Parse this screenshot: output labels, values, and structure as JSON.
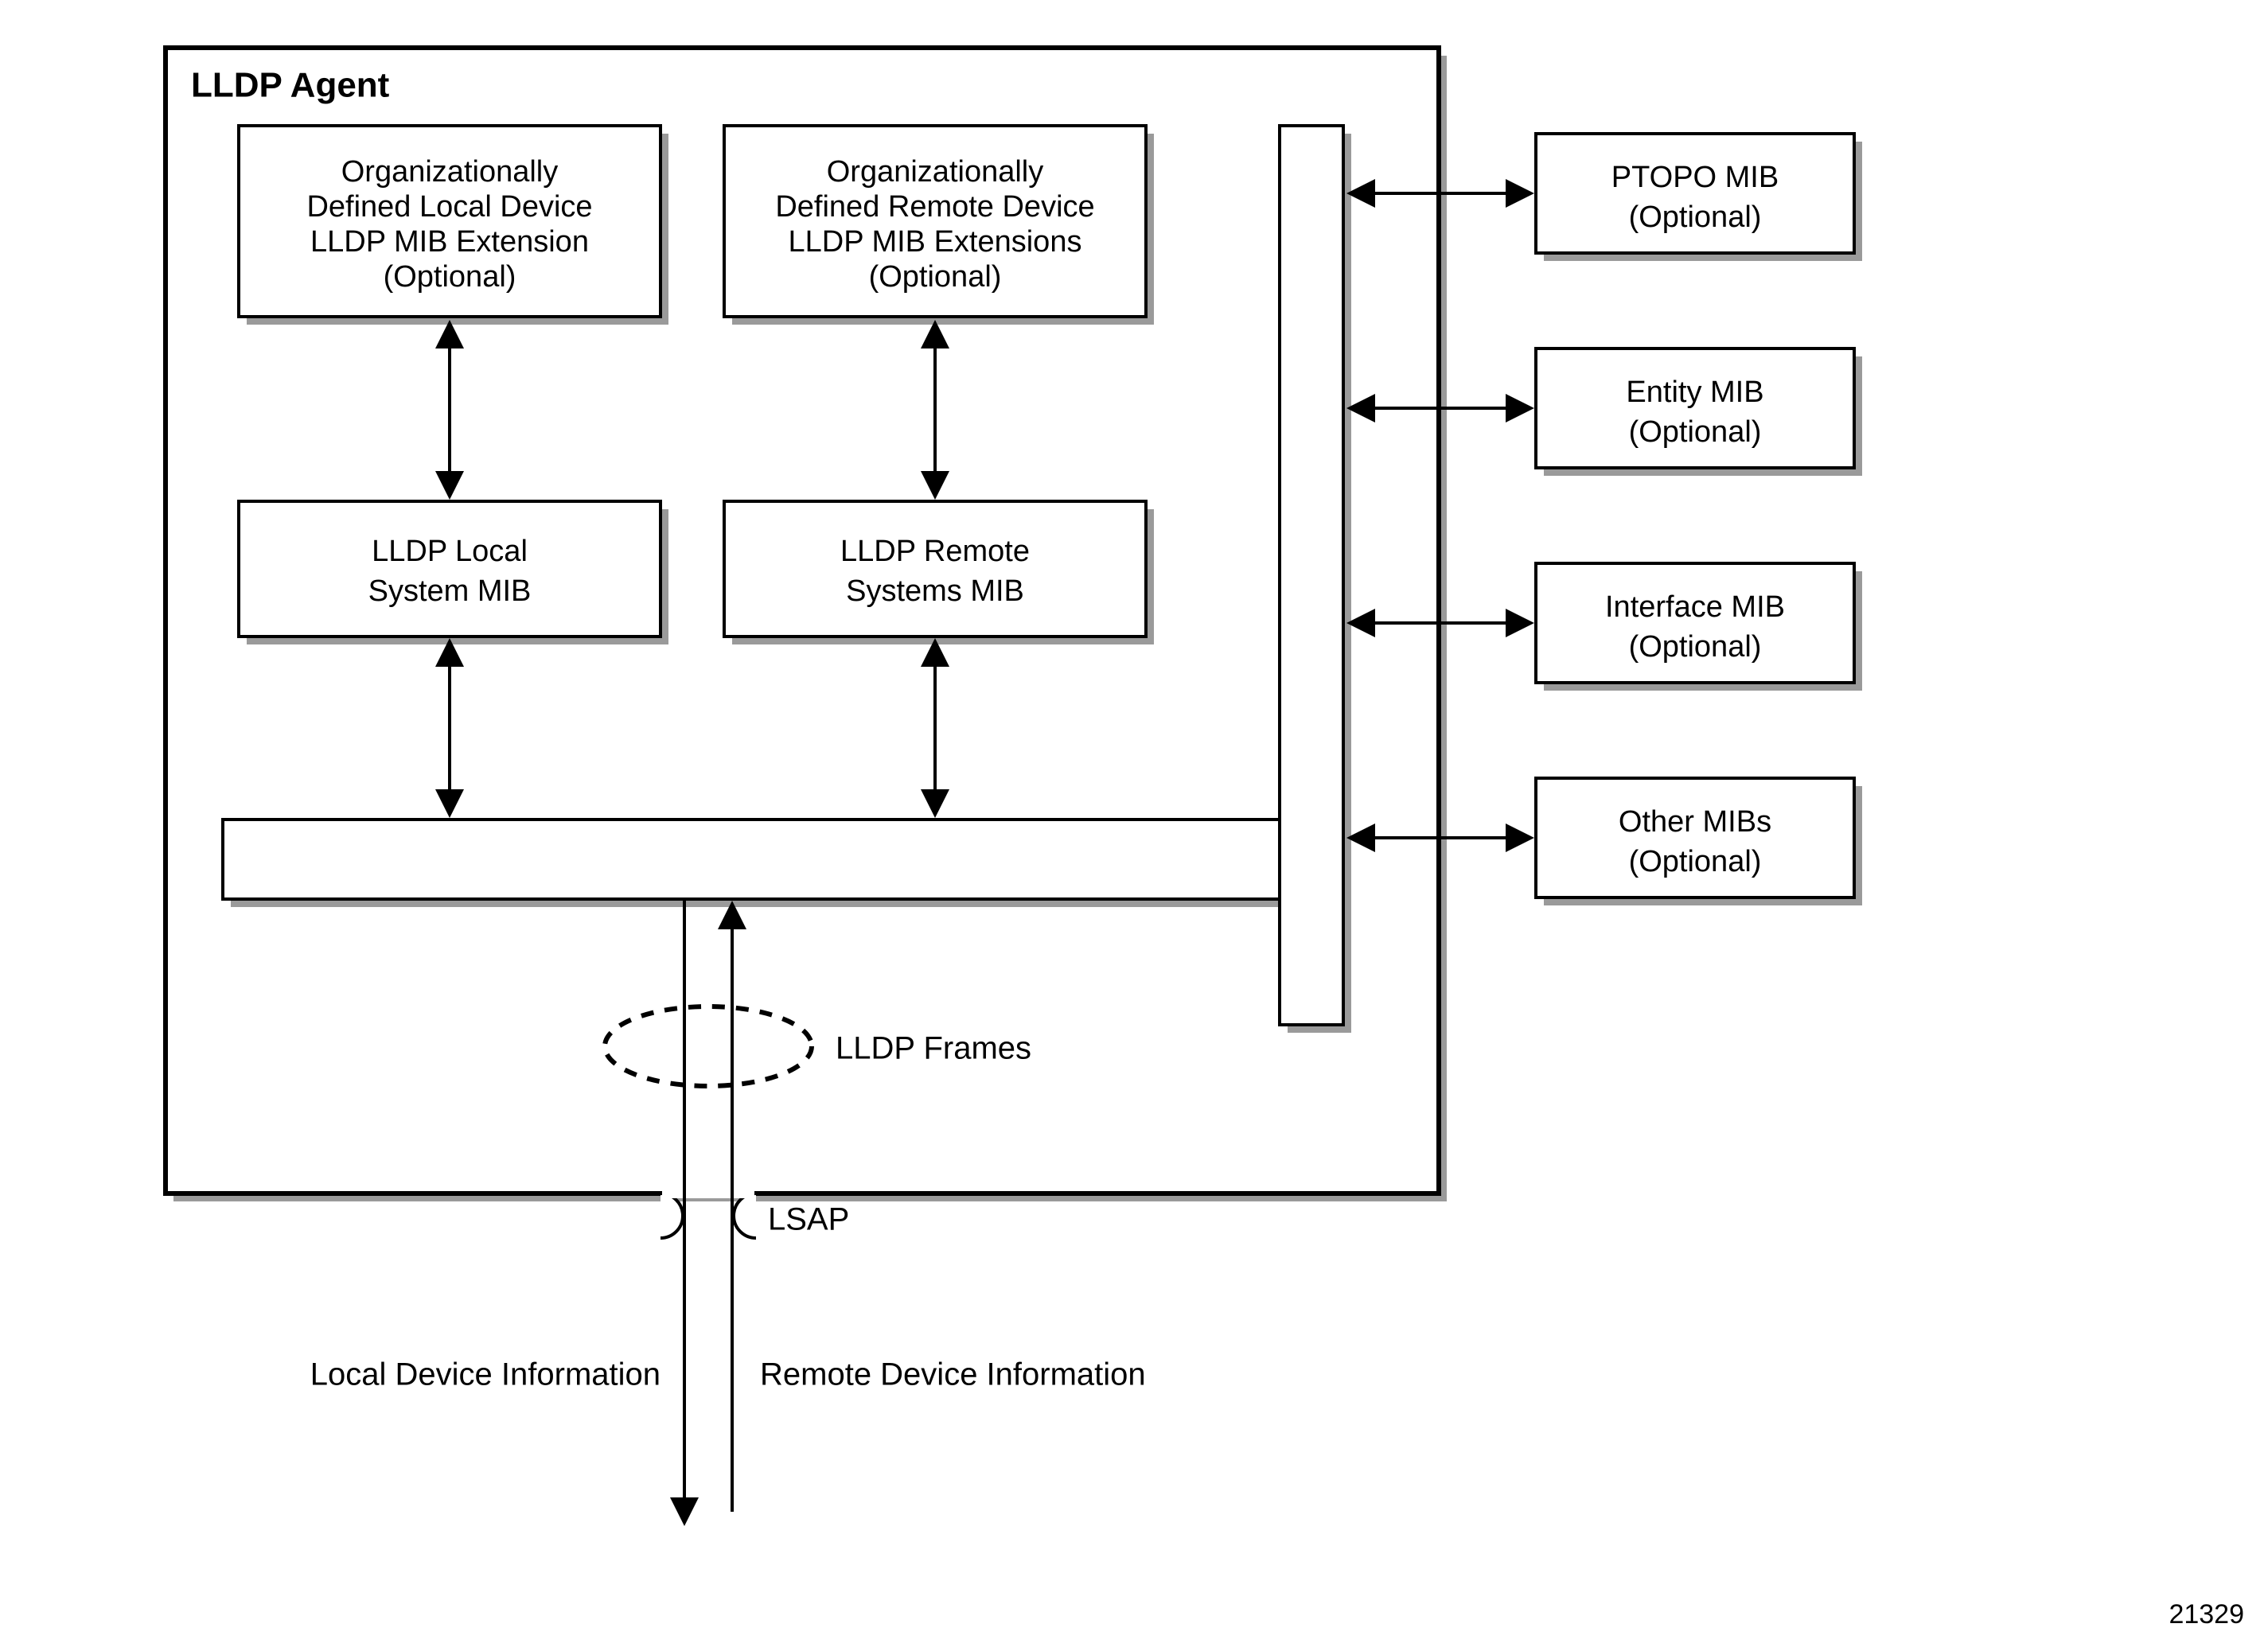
{
  "agent": {
    "title": "LLDP Agent",
    "boxes": {
      "org_local": [
        "Organizationally",
        "Defined Local Device",
        "LLDP MIB Extension",
        "(Optional)"
      ],
      "org_remote": [
        "Organizationally",
        "Defined Remote Device",
        "LLDP MIB Extensions",
        "(Optional)"
      ],
      "local_mib": [
        "LLDP Local",
        "System MIB"
      ],
      "remote_mib": [
        "LLDP Remote",
        "Systems MIB"
      ]
    }
  },
  "ext_mibs": {
    "ptopo": [
      "PTOPO MIB",
      "(Optional)"
    ],
    "entity": [
      "Entity MIB",
      "(Optional)"
    ],
    "interface": [
      "Interface MIB",
      "(Optional)"
    ],
    "other": [
      "Other MIBs",
      "(Optional)"
    ]
  },
  "labels": {
    "lldp_frames": "LLDP Frames",
    "lsap": "LSAP",
    "local_info": "Local Device Information",
    "remote_info": "Remote Device Information"
  },
  "figure_id": "21329"
}
